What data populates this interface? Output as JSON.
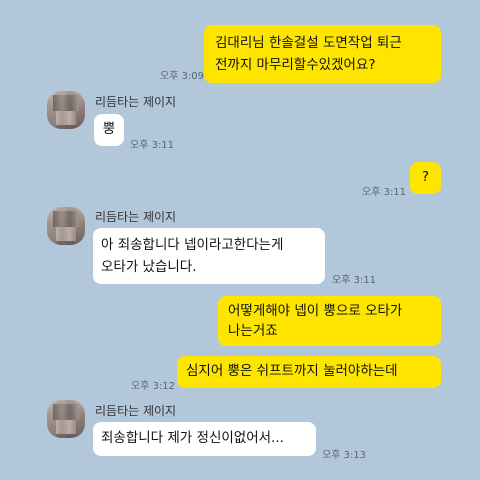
{
  "messages": [
    {
      "type": "me",
      "text": "김대리님 한솔걸설 도면작업 퇴근\n전까지 마무리할수있겠어요?",
      "time": "오후 3:09"
    },
    {
      "type": "other",
      "sender": "리듬타는 제이지",
      "text": "뿡",
      "time": "오후 3:11"
    },
    {
      "type": "me",
      "text": "?",
      "time": "오후 3:11"
    },
    {
      "type": "other",
      "sender": "리듬타는 제이지",
      "text": "아 죄송합니다 넵이라고한다는게\n오타가 났습니다.",
      "time": "오후 3:11"
    },
    {
      "type": "me",
      "text": "어떻게해야 넵이 뿡으로 오타가\n나는거죠",
      "time": ""
    },
    {
      "type": "me",
      "text": "심지어 뿡은 쉬프트까지 눌러야하는데",
      "time": "오후 3:12"
    },
    {
      "type": "other",
      "sender": "리듬타는 제이지",
      "text": "죄송합니다 제가 정신이없어서...",
      "time": "오후 3:13"
    }
  ]
}
